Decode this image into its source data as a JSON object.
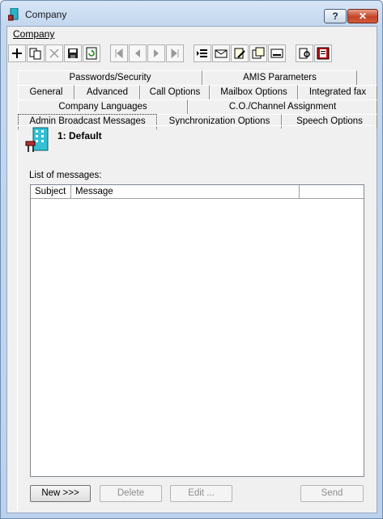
{
  "window": {
    "title": "Company"
  },
  "titlebar_buttons": {
    "help": "?",
    "close": "✕"
  },
  "menu": {
    "company": "Company"
  },
  "toolbar": {
    "tools": [
      "add-icon",
      "copy-icon",
      "delete-icon",
      "save-icon",
      "refresh-icon",
      "first-record-icon",
      "previous-record-icon",
      "next-record-icon",
      "last-record-icon",
      "list-icon",
      "mail-icon",
      "edit-properties-icon",
      "documents-icon",
      "card-icon",
      "find-icon",
      "exit-icon"
    ]
  },
  "tabs": {
    "row1": [
      "Passwords/Security",
      "AMIS Parameters"
    ],
    "row2": [
      "General",
      "Advanced",
      "Call Options",
      "Mailbox Options",
      "Integrated fax"
    ],
    "row3": [
      "Company Languages",
      "C.O./Channel Assignment"
    ],
    "row4": [
      "Admin Broadcast Messages",
      "Synchronization Options",
      "Speech Options"
    ]
  },
  "company": {
    "name": "1: Default"
  },
  "messages": {
    "label": "List of messages:",
    "columns": [
      "Subject",
      "Message",
      ""
    ],
    "rows": []
  },
  "buttons": {
    "new": "New >>>",
    "delete": "Delete",
    "edit": "Edit ...",
    "send": "Send"
  }
}
